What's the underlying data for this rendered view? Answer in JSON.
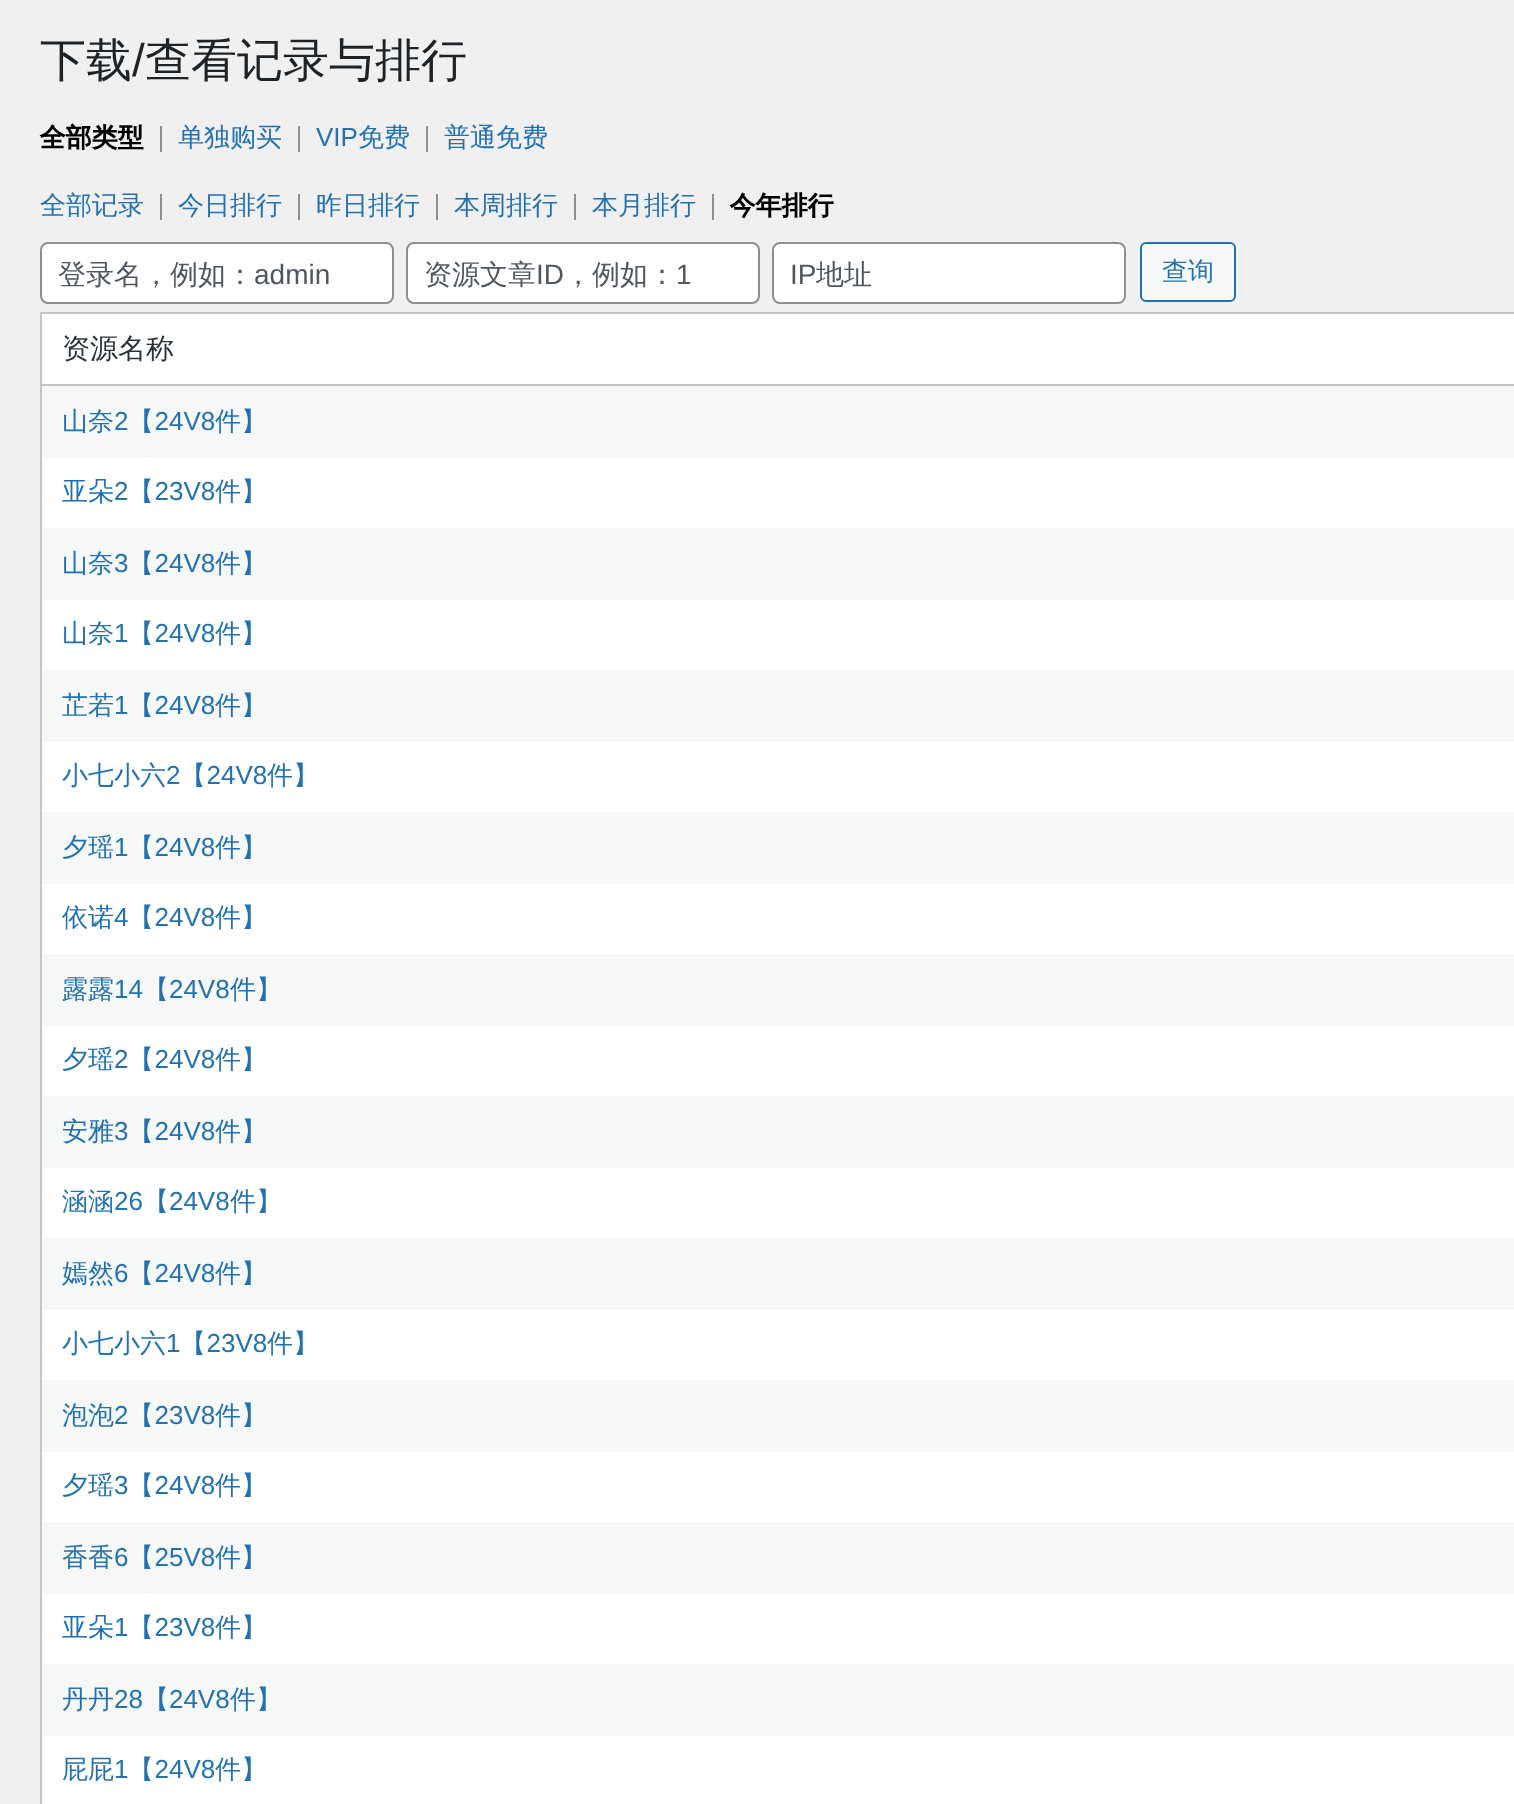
{
  "title": "下载/查看记录与排行",
  "type_filters": [
    {
      "label": "全部类型",
      "selected": true
    },
    {
      "label": "单独购买",
      "selected": false
    },
    {
      "label": "VIP免费",
      "selected": false
    },
    {
      "label": "普通免费",
      "selected": false
    }
  ],
  "range_filters": [
    {
      "label": "全部记录",
      "selected": false
    },
    {
      "label": "今日排行",
      "selected": false
    },
    {
      "label": "昨日排行",
      "selected": false
    },
    {
      "label": "本周排行",
      "selected": false
    },
    {
      "label": "本月排行",
      "selected": false
    },
    {
      "label": "今年排行",
      "selected": true
    }
  ],
  "search": {
    "fields": [
      {
        "placeholder": "登录名，例如：admin"
      },
      {
        "placeholder": "资源文章ID，例如：1"
      },
      {
        "placeholder": "IP地址"
      }
    ],
    "button": "查询"
  },
  "table": {
    "columns": [
      "资源名称"
    ],
    "rows": [
      "山奈2【24V8件】",
      "亚朵2【23V8件】",
      "山奈3【24V8件】",
      "山奈1【24V8件】",
      "芷若1【24V8件】",
      "小七小六2【24V8件】",
      "夕瑶1【24V8件】",
      "依诺4【24V8件】",
      "露露14【24V8件】",
      "夕瑶2【24V8件】",
      "安雅3【24V8件】",
      "涵涵26【24V8件】",
      "嫣然6【24V8件】",
      "小七小六1【23V8件】",
      "泡泡2【23V8件】",
      "夕瑶3【24V8件】",
      "香香6【25V8件】",
      "亚朵1【23V8件】",
      "丹丹28【24V8件】",
      "屁屁1【24V8件】"
    ]
  }
}
